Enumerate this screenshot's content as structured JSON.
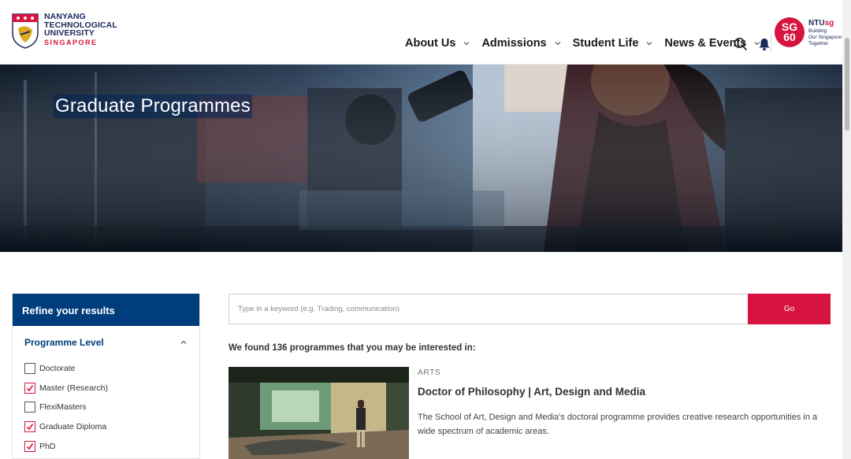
{
  "header": {
    "logo": {
      "line1": "NANYANG",
      "line2": "TECHNOLOGICAL",
      "line3": "UNIVERSITY",
      "line4": "SINGAPORE"
    },
    "nav": [
      {
        "label": "About Us"
      },
      {
        "label": "Admissions"
      },
      {
        "label": "Student Life"
      },
      {
        "label": "News & Events"
      }
    ],
    "sg60": {
      "line1": "SG",
      "line2": "60"
    },
    "ntusg": {
      "prefix": "NTU",
      "suffix": "sg",
      "tagline1": "Building",
      "tagline2": "Our Singapore",
      "tagline3": "Together"
    }
  },
  "hero": {
    "title": "Graduate Programmes"
  },
  "sidebar": {
    "heading": "Refine your results",
    "group_title": "Programme Level",
    "options": [
      {
        "label": "Doctorate",
        "checked": false
      },
      {
        "label": "Master (Research)",
        "checked": true
      },
      {
        "label": "FlexiMasters",
        "checked": false
      },
      {
        "label": "Graduate Diploma",
        "checked": true
      },
      {
        "label": "PhD",
        "checked": true
      }
    ]
  },
  "search": {
    "placeholder": "Type in a keyword (e.g. Trading, communication)",
    "value": "",
    "button_label": "Go"
  },
  "results": {
    "summary": "We found 136 programmes that you may be interested in:",
    "items": [
      {
        "category": "ARTS",
        "title": "Doctor of Philosophy | Art, Design and Media",
        "description": "The School of Art, Design and Media's doctoral programme provides creative research opportunities in a wide spectrum of academic areas."
      }
    ]
  },
  "colors": {
    "brand_red": "#d71440",
    "brand_blue": "#003d7c",
    "navy": "#1c2a5c"
  }
}
